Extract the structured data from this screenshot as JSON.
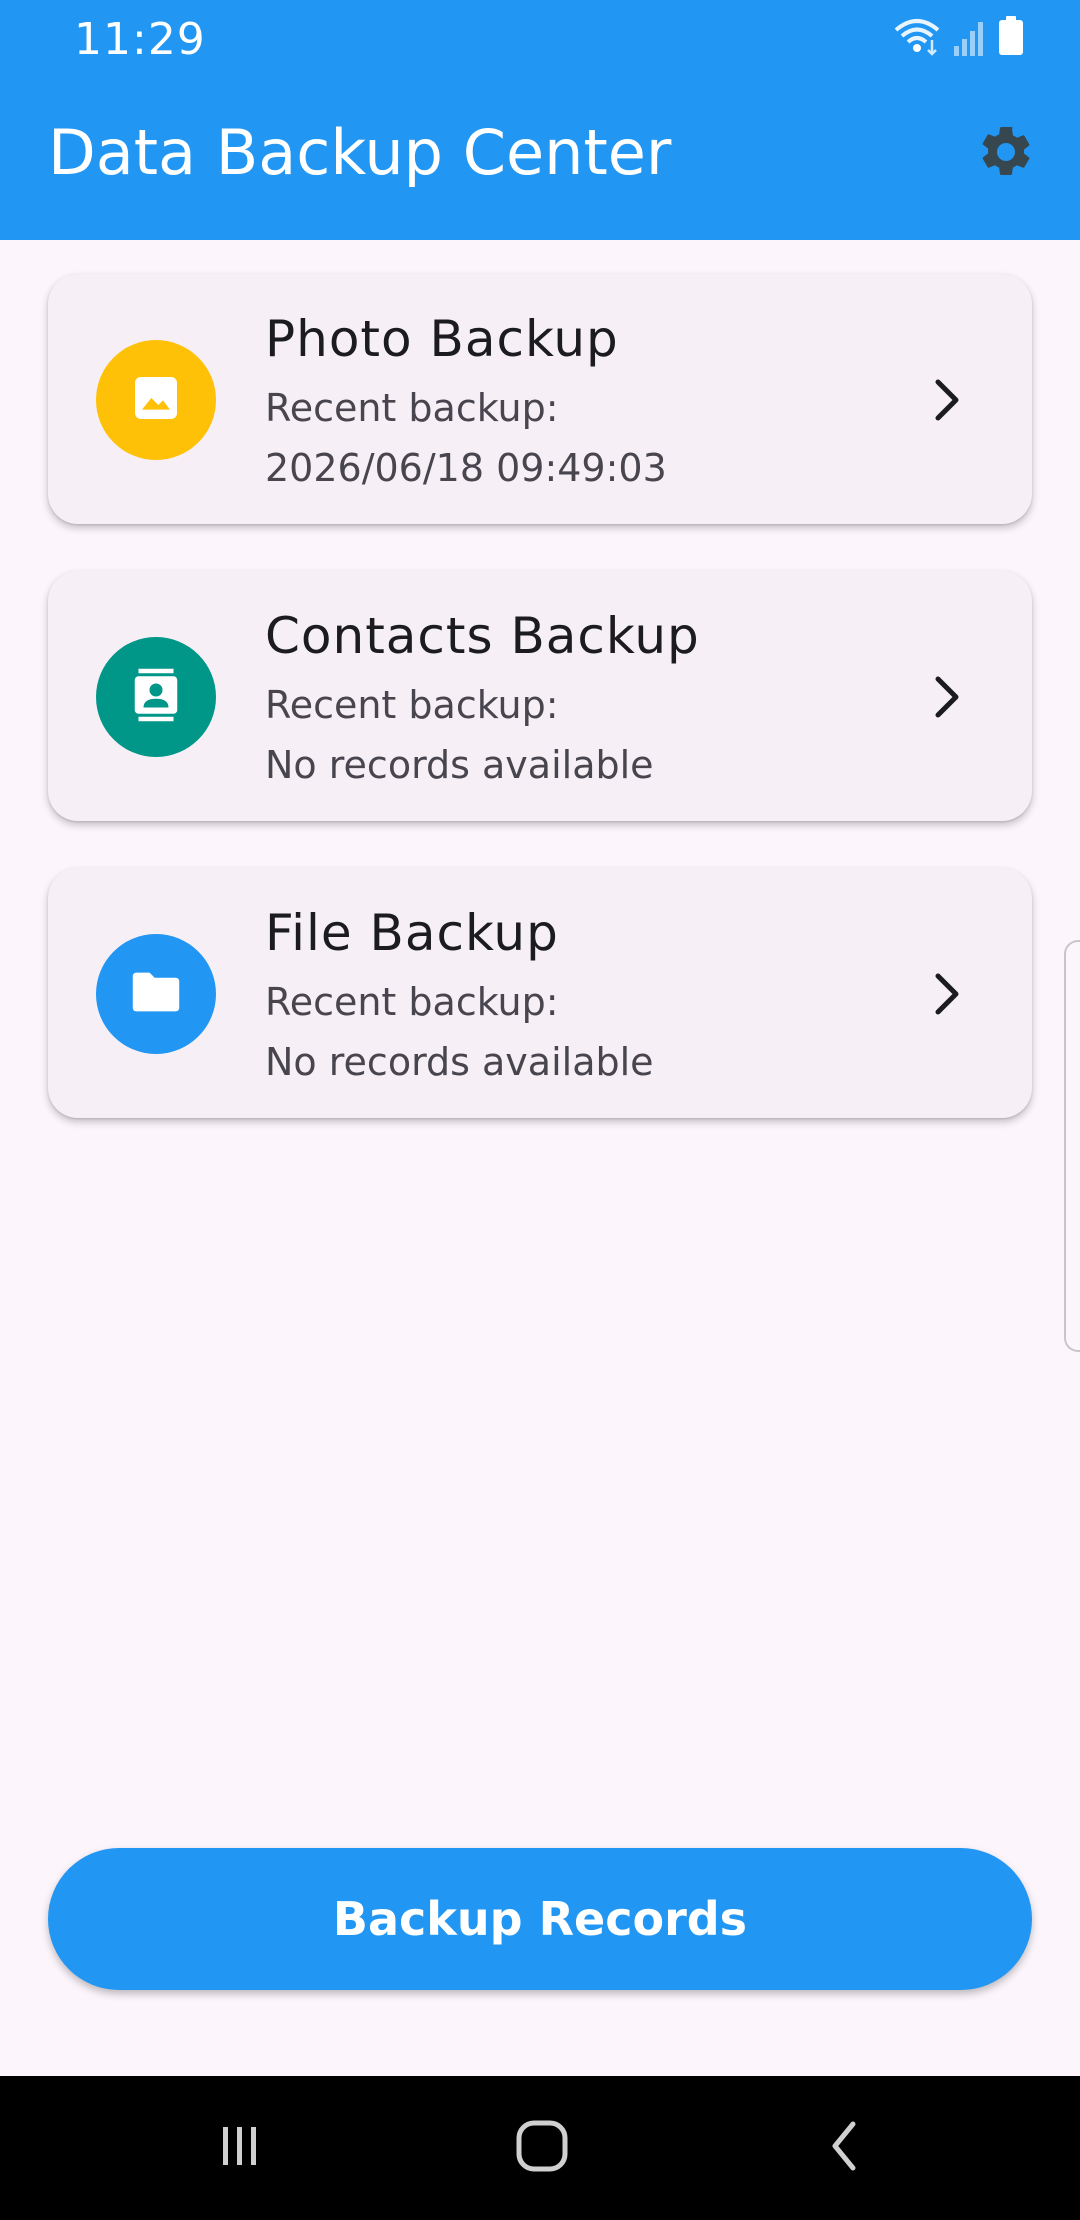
{
  "status_bar": {
    "time": "11:29",
    "icons": [
      "wifi-icon",
      "signal-icon",
      "battery-icon"
    ]
  },
  "app_bar": {
    "title": "Data Backup Center",
    "settings_icon": "gear-icon"
  },
  "colors": {
    "primary": "#2196f3",
    "photo_accent": "#ffc107",
    "contacts_accent": "#009688",
    "file_accent": "#2196f3",
    "background": "#fcf6fc",
    "card": "#f6f0f6"
  },
  "backup_items": [
    {
      "title": "Photo Backup",
      "subtitle_label": "Recent backup:",
      "subtitle_value": "2026/06/18 09:49:03",
      "icon": "image-icon"
    },
    {
      "title": "Contacts Backup",
      "subtitle_label": "Recent backup:",
      "subtitle_value": "No records available",
      "icon": "contact-icon"
    },
    {
      "title": "File Backup",
      "subtitle_label": "Recent backup:",
      "subtitle_value": "No records available",
      "icon": "folder-icon"
    }
  ],
  "primary_action": {
    "label": "Backup Records"
  },
  "nav_bar": {
    "icons": [
      "recents-icon",
      "home-icon",
      "back-icon"
    ]
  }
}
